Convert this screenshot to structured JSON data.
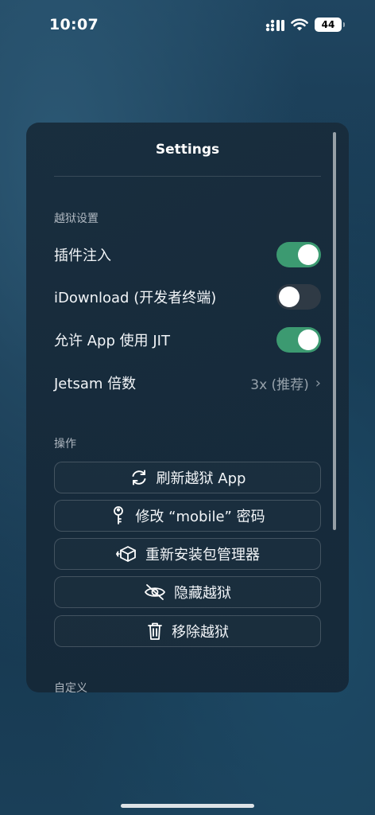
{
  "status_bar": {
    "time": "10:07",
    "battery": "44"
  },
  "settings": {
    "title": "Settings",
    "sections": {
      "jailbreak": {
        "header": "越狱设置",
        "tweak_injection": {
          "label": "插件注入",
          "on": true
        },
        "idownload": {
          "label": "iDownload (开发者终端)",
          "on": false
        },
        "allow_jit": {
          "label": "允许 App 使用 JIT",
          "on": true
        },
        "jetsam": {
          "label": "Jetsam 倍数",
          "value": "3x (推荐)"
        }
      },
      "actions": {
        "header": "操作",
        "refresh": "刷新越狱 App",
        "change_password": "修改 “mobile” 密码",
        "reinstall_pm": "重新安装包管理器",
        "hide": "隐藏越狱",
        "remove": "移除越狱"
      },
      "custom": {
        "header": "自定义"
      }
    }
  },
  "colors": {
    "toggle_on": "#3c9a71",
    "toggle_off": "#2f3a45",
    "panel": "#182c3c"
  },
  "icons": {
    "refresh": "refresh-icon",
    "key": "key-icon",
    "package": "package-icon",
    "hide": "eye-slash-icon",
    "trash": "trash-icon"
  }
}
